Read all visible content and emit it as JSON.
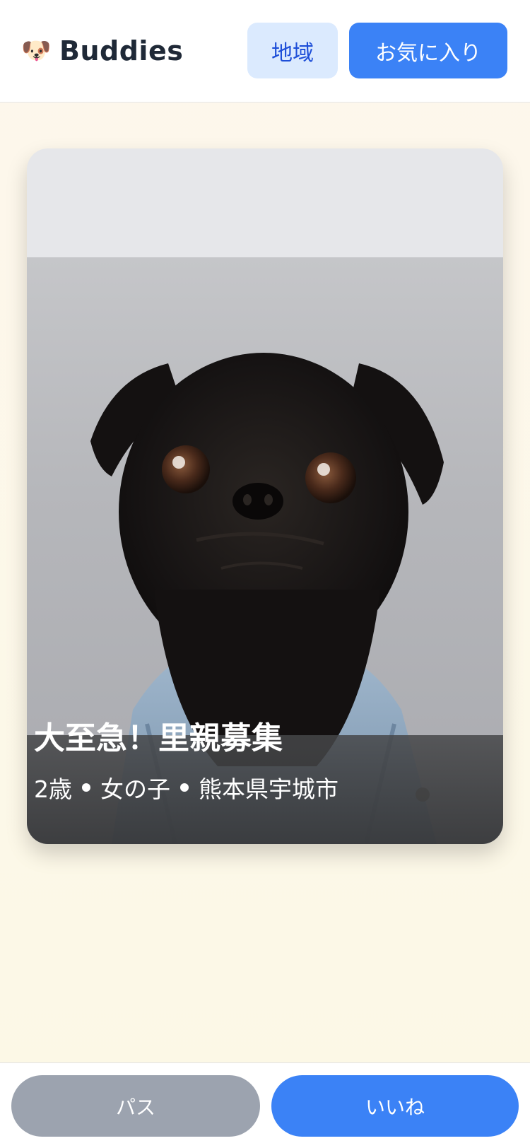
{
  "header": {
    "brand_icon": "dog-face-icon",
    "brand_name": "Buddies",
    "region_label": "地域",
    "favorites_label": "お気に入り"
  },
  "card": {
    "title": "大至急！里親募集",
    "age": "2歳",
    "sex": "女の子",
    "location": "熊本県宇城市"
  },
  "actions": {
    "pass_label": "パス",
    "like_label": "いいね"
  },
  "colors": {
    "accent": "#3b82f6",
    "accent_light": "#dbeafe",
    "pass_gray": "#9ca3af",
    "page_bg": "#fcf8e6"
  }
}
